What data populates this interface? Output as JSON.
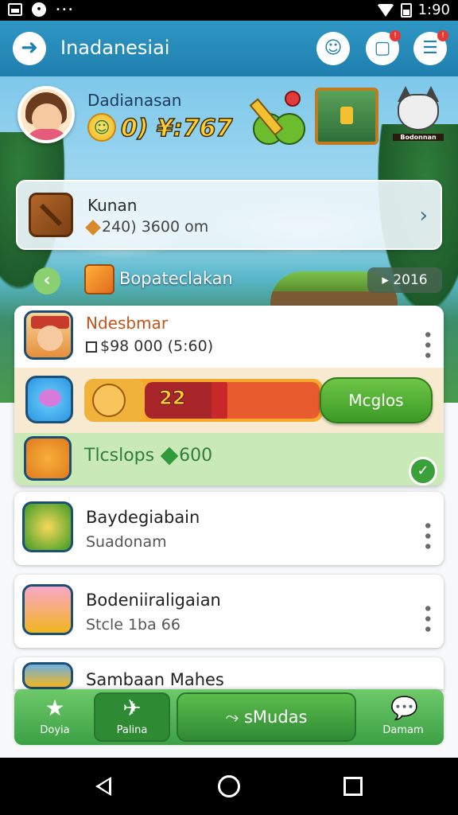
{
  "status_bar": {
    "time": "1:90"
  },
  "app_bar": {
    "title": "Inadanesiai",
    "notif_badge": "!",
    "menu_badge": "!"
  },
  "player": {
    "name": "Dadianasan",
    "coins": "0) ¥:767"
  },
  "items": {
    "cat_label": "Bodonnan"
  },
  "kunan_card": {
    "title": "Kunan",
    "subtitle": "240) 3600 om"
  },
  "banner_row": {
    "label": "Bopateclakan",
    "chip": "2016"
  },
  "expanded_card": {
    "title": "Ndesbmar",
    "subtitle": "$98 000 (5:60)",
    "progress_value": "22",
    "progress_fraction": 0.78,
    "action_button": "Mcglos",
    "footer_text": "Tlcslops",
    "footer_value": "600"
  },
  "cards": [
    {
      "title": "Baydegiabain",
      "subtitle": "Suadonam",
      "icon": "coin-icon"
    },
    {
      "title": "Bodeniiraligaian",
      "subtitle": "Stcle 1ba 66",
      "icon": "game-logo-icon"
    },
    {
      "title": "Sambaan Mahes",
      "subtitle": "",
      "icon": "treasure-icon"
    }
  ],
  "bottom_nav": {
    "items": [
      {
        "label": "Doyia",
        "icon": "star-icon"
      },
      {
        "label": "Palina",
        "icon": "sword-icon"
      },
      {
        "label": "sMudas",
        "icon": "activity-icon"
      },
      {
        "label": "Damam",
        "icon": "chat-icon"
      }
    ]
  },
  "colors": {
    "app_bar": "#2f97c4",
    "accent_green": "#3ba044",
    "progress_red": "#a8262a",
    "highlight_orange": "#c0561b"
  }
}
